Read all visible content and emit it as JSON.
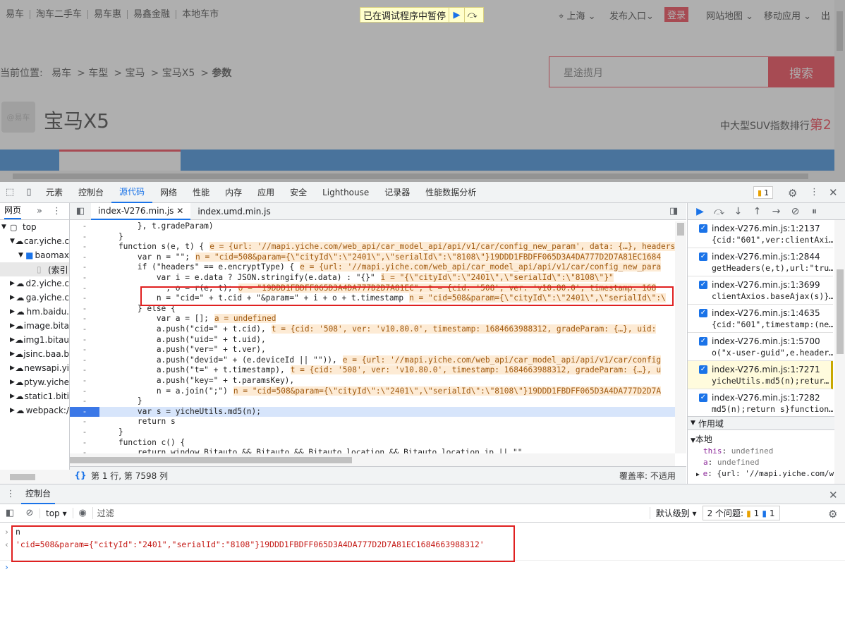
{
  "site": {
    "top_links": [
      "易车",
      "淘车二手车",
      "易车惠",
      "易鑫金融",
      "本地车市"
    ],
    "debugger_paused": "已在调试程序中暂停",
    "city": "上海",
    "publish": "发布入口",
    "login": "登录",
    "site_map": "网站地图",
    "mobile": "移动应用",
    "exit": "出",
    "breadcrumb_prefix": "当前位置:",
    "breadcrumb": [
      "易车",
      "车型",
      "宝马",
      "宝马X5",
      "参数"
    ],
    "search_value": "星途揽月",
    "search_button": "搜索",
    "car_title": "宝马X5",
    "rank_text": "中大型SUV指数排行",
    "rank_value": "第2",
    "logo_text": "@易车"
  },
  "devtools": {
    "tabs": [
      "元素",
      "控制台",
      "源代码",
      "网络",
      "性能",
      "内存",
      "应用",
      "安全",
      "Lighthouse",
      "记录器",
      "性能数据分析"
    ],
    "active_tab": "源代码",
    "issue_count": "1",
    "navigator": {
      "tab": "网页",
      "items": [
        "top",
        "car.yiche.c",
        "baomax",
        "(索引",
        "d2.yiche.c",
        "ga.yiche.c",
        "hm.baidu.",
        "image.bita",
        "img1.bitau",
        "jsinc.baa.b",
        "newsapi.yi",
        "ptyw.yiche",
        "static1.biti",
        "webpack:/"
      ]
    },
    "editor_tabs": [
      "index-V276.min.js",
      "index.umd.min.js"
    ],
    "code_lines": [
      "        }, t.gradeParam)",
      "    }",
      "    function s(e, t) {",
      "        var n = \"\";",
      "        if (\"headers\" == e.encryptType) {",
      "            var i = e.data ? JSON.stringify(e.data) : \"{}\"",
      "              , o = r(e, t);",
      "            n = \"cid=\" + t.cid + \"&param=\" + i + o + t.timestamp",
      "        } else {",
      "            var a = [];",
      "            a.push(\"cid=\" + t.cid),",
      "            a.push(\"uid=\" + t.uid),",
      "            a.push(\"ver=\" + t.ver),",
      "            a.push(\"devid=\" + (e.deviceId || \"\")),",
      "            a.push(\"t=\" + t.timestamp),",
      "            a.push(\"key=\" + t.paramsKey),",
      "            n = a.join(\";\")",
      "        }",
      "        var s = yicheUtils.md5(n);",
      "        return s",
      "    }",
      "    function c() {",
      "        return window.Bitauto && Bitauto && Bitauto.location && Bitauto.location.ip || \"\""
    ],
    "inline_values": [
      "",
      "",
      "e = {url: '//mapi.yiche.com/web_api/car_model_api/api/v1/car/config_new_param', data: {…}, headers",
      "n = \"cid=508&param={\\\"cityId\\\":\\\"2401\\\",\\\"serialId\\\":\\\"8108\\\"}19DDD1FBDFF065D3A4DA777D2D7A81EC1684",
      "e = {url: '//mapi.yiche.com/web_api/car_model_api/api/v1/car/config_new_para",
      "i = \"{\\\"cityId\\\":\\\"2401\\\",\\\"serialId\\\":\\\"8108\\\"}\"",
      "o = \"19DDD1FBDFF065D3A4DA777D2D7A81EC\", t = {cid: '508', ver: 'v10.80.0', timestamp: 168",
      "n = \"cid=508&param={\\\"cityId\\\":\\\"2401\\\",\\\"serialId\\\":\\",
      "",
      "a = undefined",
      "t = {cid: '508', ver: 'v10.80.0', timestamp: 1684663988312, gradeParam: {…}, uid:",
      "",
      "",
      "e = {url: '//mapi.yiche.com/web_api/car_model_api/api/v1/car/config",
      "t = {cid: '508', ver: 'v10.80.0', timestamp: 1684663988312, gradeParam: {…}, u",
      "",
      "n = \"cid=508&param={\\\"cityId\\\":\\\"2401\\\",\\\"serialId\\\":\\\"8108\\\"}19DDD1FBDFF065D3A4DA777D2D7A",
      "",
      "",
      "",
      "",
      "",
      ""
    ],
    "status_position": "第 1 行, 第 7598 列",
    "coverage": "覆盖率: 不适用",
    "breakpoints": [
      {
        "file": "index-V276.min.js:1:2137",
        "code": "{cid:\"601\",ver:clientAxi…"
      },
      {
        "file": "index-V276.min.js:1:2844",
        "code": "getHeaders(e,t),url:\"tru…"
      },
      {
        "file": "index-V276.min.js:1:3699",
        "code": "clientAxios.baseAjax(s)}…"
      },
      {
        "file": "index-V276.min.js:1:4635",
        "code": "{cid:\"601\",timestamp:(ne…"
      },
      {
        "file": "index-V276.min.js:1:5700",
        "code": "o(\"x-user-guid\",e.header…"
      },
      {
        "file": "index-V276.min.js:1:7271",
        "code": "yicheUtils.md5(n);retur…"
      },
      {
        "file": "index-V276.min.js:1:7282",
        "code": "md5(n);return s}function…"
      }
    ],
    "scope": {
      "title": "作用域",
      "local": "本地",
      "vars": [
        {
          "name": "this",
          "value": "undefined"
        },
        {
          "name": "a",
          "value": "undefined"
        },
        {
          "name": "e",
          "value": "{url: '//mapi.yiche.com/w"
        }
      ]
    },
    "console": {
      "title": "控制台",
      "context": "top",
      "filter_placeholder": "过滤",
      "level": "默认级别",
      "issues_label": "2 个问题:",
      "warn_count": "1",
      "info_count": "1",
      "input": "n",
      "output": "'cid=508&param={\"cityId\":\"2401\",\"serialId\":\"8108\"}19DDD1FBDFF065D3A4DA777D2D7A81EC1684663988312'"
    }
  }
}
